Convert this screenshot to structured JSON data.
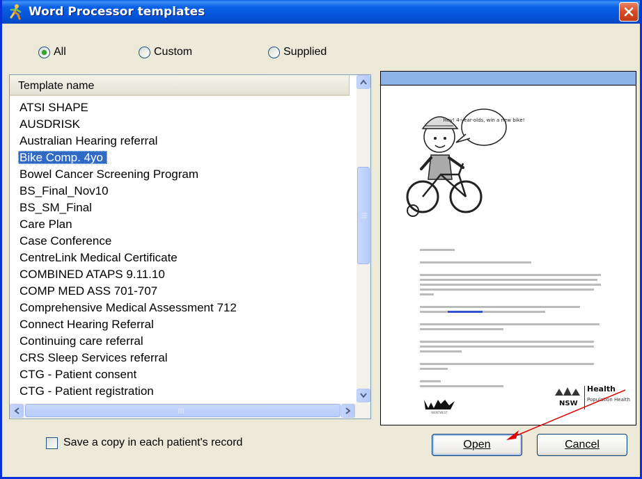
{
  "window": {
    "title": "Word Processor templates"
  },
  "filter": {
    "options": [
      {
        "label": "All",
        "checked": true
      },
      {
        "label": "Custom",
        "checked": false
      },
      {
        "label": "Supplied",
        "checked": false
      }
    ]
  },
  "list": {
    "header": "Template name",
    "items": [
      "ATSI SHAPE",
      "AUSDRISK",
      "Australian Hearing referral",
      "Bike Comp. 4yo",
      "Bowel Cancer Screening Program",
      "BS_Final_Nov10",
      "BS_SM_Final",
      "Care Plan",
      "Case Conference",
      "CentreLink Medical Certificate",
      "COMBINED ATAPS 9.11.10",
      "COMP MED ASS 701-707",
      "Comprehensive Medical Assessment 712",
      "Connect Hearing Referral",
      "Continuing care referral",
      "CRS Sleep Services referral",
      "CTG - Patient consent",
      "CTG - Patient registration"
    ],
    "selected_index": 3
  },
  "preview": {
    "speech_bubble": "Hey! 4-year-olds, win a new bike!",
    "logo_left": "WENTWEST",
    "logo_right_main": "Health",
    "logo_right_sub": "Population Health",
    "logo_right_state": "NSW"
  },
  "footer": {
    "save_copy_label": "Save a copy in each patient's record",
    "open_label": "Open",
    "cancel_label": "Cancel"
  },
  "colors": {
    "selection": "#316ac5",
    "titlebar": "#0553d8",
    "annotation_arrow": "#e00000"
  }
}
